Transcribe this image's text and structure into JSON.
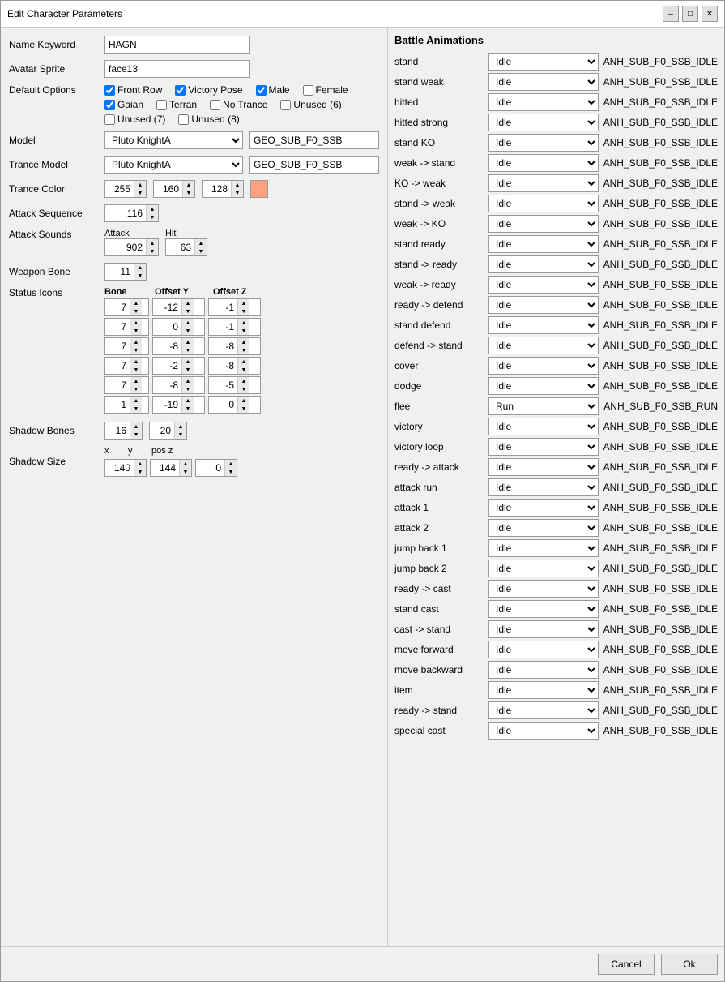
{
  "window": {
    "title": "Edit Character Parameters"
  },
  "left": {
    "name_keyword_label": "Name Keyword",
    "name_keyword_value": "HAGN",
    "avatar_sprite_label": "Avatar Sprite",
    "avatar_sprite_value": "face13",
    "default_options_label": "Default Options",
    "checkboxes": {
      "front_row": {
        "label": "Front Row",
        "checked": true
      },
      "victory_pose": {
        "label": "Victory Pose",
        "checked": true
      },
      "male": {
        "label": "Male",
        "checked": true
      },
      "female": {
        "label": "Female",
        "checked": false
      },
      "gaian": {
        "label": "Gaian",
        "checked": true
      },
      "terran": {
        "label": "Terran",
        "checked": false
      },
      "no_trance": {
        "label": "No Trance",
        "checked": false
      },
      "unused6": {
        "label": "Unused (6)",
        "checked": false
      },
      "unused7": {
        "label": "Unused (7)",
        "checked": false
      },
      "unused8": {
        "label": "Unused (8)",
        "checked": false
      }
    },
    "model_label": "Model",
    "model_select": "Pluto KnightA",
    "model_input": "GEO_SUB_F0_SSB",
    "trance_model_label": "Trance Model",
    "trance_model_select": "Pluto KnightA",
    "trance_model_input": "GEO_SUB_F0_SSB",
    "trance_color_label": "Trance Color",
    "trance_color_r": "255",
    "trance_color_g": "160",
    "trance_color_b": "128",
    "trance_color_hex": "#ffa080",
    "attack_sequence_label": "Attack Sequence",
    "attack_sequence_value": "116",
    "attack_sounds_label": "Attack Sounds",
    "attack_label": "Attack",
    "attack_value": "902",
    "hit_label": "Hit",
    "hit_value": "63",
    "weapon_bone_label": "Weapon Bone",
    "weapon_bone_value": "11",
    "status_icons_label": "Status Icons",
    "status_icons_headers": [
      "Bone",
      "Offset Y",
      "Offset Z"
    ],
    "status_icons_rows": [
      {
        "bone": "7",
        "offset_y": "-12",
        "offset_z": "-1"
      },
      {
        "bone": "7",
        "offset_y": "0",
        "offset_z": "-1"
      },
      {
        "bone": "7",
        "offset_y": "-8",
        "offset_z": "-8"
      },
      {
        "bone": "7",
        "offset_y": "-2",
        "offset_z": "-8"
      },
      {
        "bone": "7",
        "offset_y": "-8",
        "offset_z": "-5"
      },
      {
        "bone": "1",
        "offset_y": "-19",
        "offset_z": "0"
      }
    ],
    "shadow_bones_label": "Shadow Bones",
    "shadow_bones_val1": "16",
    "shadow_bones_val2": "20",
    "shadow_size_label": "Shadow Size",
    "shadow_x_label": "x",
    "shadow_y_label": "y",
    "shadow_posz_label": "pos z",
    "shadow_x": "140",
    "shadow_y": "144",
    "shadow_posz": "0"
  },
  "right": {
    "title": "Battle Animations",
    "animations": [
      {
        "label": "stand",
        "select": "Idle",
        "value": "ANH_SUB_F0_SSB_IDLE"
      },
      {
        "label": "stand weak",
        "select": "Idle",
        "value": "ANH_SUB_F0_SSB_IDLE"
      },
      {
        "label": "hitted",
        "select": "Idle",
        "value": "ANH_SUB_F0_SSB_IDLE"
      },
      {
        "label": "hitted strong",
        "select": "Idle",
        "value": "ANH_SUB_F0_SSB_IDLE"
      },
      {
        "label": "stand KO",
        "select": "Idle",
        "value": "ANH_SUB_F0_SSB_IDLE"
      },
      {
        "label": "weak -> stand",
        "select": "Idle",
        "value": "ANH_SUB_F0_SSB_IDLE"
      },
      {
        "label": "KO -> weak",
        "select": "Idle",
        "value": "ANH_SUB_F0_SSB_IDLE"
      },
      {
        "label": "stand -> weak",
        "select": "Idle",
        "value": "ANH_SUB_F0_SSB_IDLE"
      },
      {
        "label": "weak -> KO",
        "select": "Idle",
        "value": "ANH_SUB_F0_SSB_IDLE"
      },
      {
        "label": "stand ready",
        "select": "Idle",
        "value": "ANH_SUB_F0_SSB_IDLE"
      },
      {
        "label": "stand -> ready",
        "select": "Idle",
        "value": "ANH_SUB_F0_SSB_IDLE"
      },
      {
        "label": "weak -> ready",
        "select": "Idle",
        "value": "ANH_SUB_F0_SSB_IDLE"
      },
      {
        "label": "ready -> defend",
        "select": "Idle",
        "value": "ANH_SUB_F0_SSB_IDLE"
      },
      {
        "label": "stand defend",
        "select": "Idle",
        "value": "ANH_SUB_F0_SSB_IDLE"
      },
      {
        "label": "defend -> stand",
        "select": "Idle",
        "value": "ANH_SUB_F0_SSB_IDLE"
      },
      {
        "label": "cover",
        "select": "Idle",
        "value": "ANH_SUB_F0_SSB_IDLE"
      },
      {
        "label": "dodge",
        "select": "Idle",
        "value": "ANH_SUB_F0_SSB_IDLE"
      },
      {
        "label": "flee",
        "select": "Run",
        "value": "ANH_SUB_F0_SSB_RUN"
      },
      {
        "label": "victory",
        "select": "Idle",
        "value": "ANH_SUB_F0_SSB_IDLE"
      },
      {
        "label": "victory loop",
        "select": "Idle",
        "value": "ANH_SUB_F0_SSB_IDLE"
      },
      {
        "label": "ready -> attack",
        "select": "Idle",
        "value": "ANH_SUB_F0_SSB_IDLE"
      },
      {
        "label": "attack run",
        "select": "Idle",
        "value": "ANH_SUB_F0_SSB_IDLE"
      },
      {
        "label": "attack 1",
        "select": "Idle",
        "value": "ANH_SUB_F0_SSB_IDLE"
      },
      {
        "label": "attack 2",
        "select": "Idle",
        "value": "ANH_SUB_F0_SSB_IDLE"
      },
      {
        "label": "jump back 1",
        "select": "Idle",
        "value": "ANH_SUB_F0_SSB_IDLE"
      },
      {
        "label": "jump back 2",
        "select": "Idle",
        "value": "ANH_SUB_F0_SSB_IDLE"
      },
      {
        "label": "ready -> cast",
        "select": "Idle",
        "value": "ANH_SUB_F0_SSB_IDLE"
      },
      {
        "label": "stand cast",
        "select": "Idle",
        "value": "ANH_SUB_F0_SSB_IDLE"
      },
      {
        "label": "cast -> stand",
        "select": "Idle",
        "value": "ANH_SUB_F0_SSB_IDLE"
      },
      {
        "label": "move forward",
        "select": "Idle",
        "value": "ANH_SUB_F0_SSB_IDLE"
      },
      {
        "label": "move backward",
        "select": "Idle",
        "value": "ANH_SUB_F0_SSB_IDLE"
      },
      {
        "label": "item",
        "select": "Idle",
        "value": "ANH_SUB_F0_SSB_IDLE"
      },
      {
        "label": "ready -> stand",
        "select": "Idle",
        "value": "ANH_SUB_F0_SSB_IDLE"
      },
      {
        "label": "special cast",
        "select": "Idle",
        "value": "ANH_SUB_F0_SSB_IDLE"
      }
    ]
  },
  "footer": {
    "cancel_label": "Cancel",
    "ok_label": "Ok"
  }
}
